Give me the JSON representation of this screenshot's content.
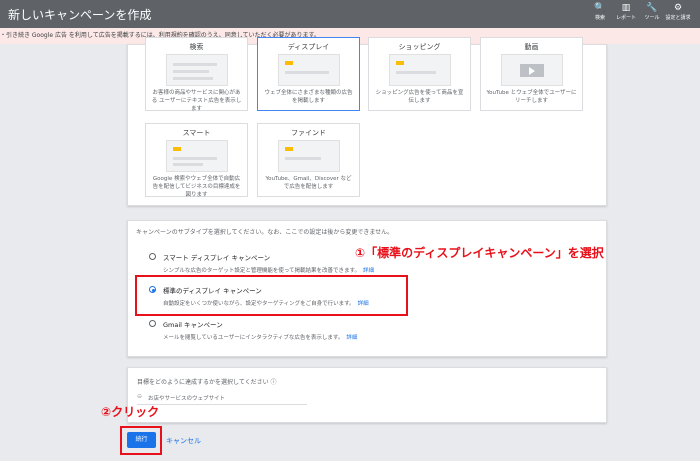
{
  "header": {
    "title": "新しいキャンペーンを作成",
    "tools": [
      {
        "icon": "search-icon",
        "glyph": "🔍",
        "label": "検索"
      },
      {
        "icon": "reports-icon",
        "glyph": "▥",
        "label": "レポート"
      },
      {
        "icon": "wrench-icon",
        "glyph": "🔧",
        "label": "ツール"
      },
      {
        "icon": "gear-icon",
        "glyph": "⚙",
        "label": "設定と請求"
      }
    ]
  },
  "notice": "・引き続き Google 広告 を利用して広告を掲載するには、利用規約を確認のうえ、同意していただく必要があります。",
  "campaign_types": [
    {
      "title": "検索",
      "desc": "お客様の商品やサービスに関心がある ユーザーにテキスト広告を表示します"
    },
    {
      "title": "ディスプレイ",
      "desc": "ウェブ全体にさまざまな種類の広告を掲載します"
    },
    {
      "title": "ショッピング",
      "desc": "ショッピング広告を使って商品を宣伝します"
    },
    {
      "title": "動画",
      "desc": "YouTube とウェブ全体でユーザーにリーチします"
    },
    {
      "title": "スマート",
      "desc": "Google 検索やウェブ全体で自動広告を配信してビジネスの目標達成を図ります"
    },
    {
      "title": "ファインド",
      "desc": "YouTube、Gmail、Discover などで広告を配信します"
    }
  ],
  "subtype": {
    "header": "キャンペーンのサブタイプを選択してください。なお、ここでの設定は後から変更できません。",
    "options": [
      {
        "title": "スマート ディスプレイ キャンペーン",
        "desc": "シンプルな広告のターゲット設定と管理機能を使って掲載結果を改善できます。",
        "link": "詳細",
        "selected": false
      },
      {
        "title": "標準のディスプレイ キャンペーン",
        "desc": "自動設定をいくつか使いながら、設定やターゲティングをご自身で行います。",
        "link": "詳細",
        "selected": true
      },
      {
        "title": "Gmail キャンペーン",
        "desc": "メールを閲覧しているユーザーにインタラクティブな広告を表示します。",
        "link": "詳細",
        "selected": false
      }
    ]
  },
  "goal": {
    "question": "目標をどのように達成するかを選択してください ⓘ",
    "option": "お店やサービスのウェブサイト"
  },
  "buttons": {
    "continue": "続行",
    "cancel": "キャンセル"
  },
  "annotations": {
    "step1": "①「標準のディスプレイキャンペーン」を選択",
    "step2": "②クリック"
  },
  "colors": {
    "accent": "#1a73e8",
    "annotation": "#e8101a",
    "header": "#5f6368"
  }
}
